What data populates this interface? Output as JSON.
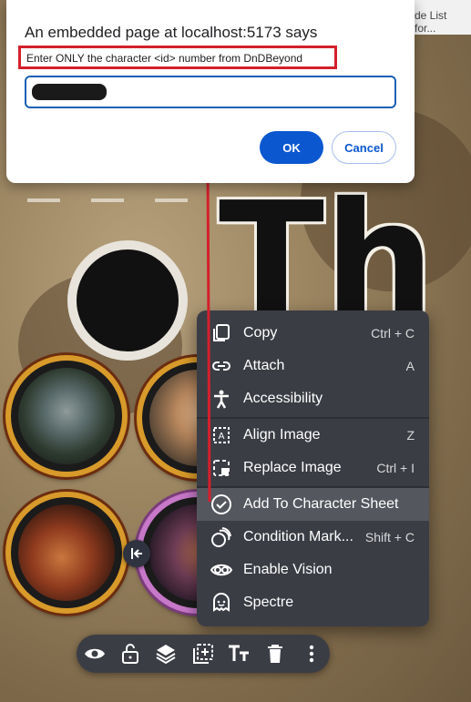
{
  "browser": {
    "tab_fragment": "de List for..."
  },
  "dialog": {
    "title": "An embedded page at localhost:5173 says",
    "message": "Enter ONLY the character <id> number from DnDBeyond",
    "input_value": "",
    "ok_label": "OK",
    "cancel_label": "Cancel"
  },
  "scene": {
    "heading_text": "Th"
  },
  "context_menu": {
    "items": [
      {
        "label": "Copy",
        "shortcut": "Ctrl + C",
        "icon": "copy-icon"
      },
      {
        "label": "Attach",
        "shortcut": "A",
        "icon": "attach-icon"
      },
      {
        "label": "Accessibility",
        "shortcut": "",
        "icon": "accessibility-icon"
      },
      {
        "label": "Align Image",
        "shortcut": "Z",
        "icon": "align-image-icon"
      },
      {
        "label": "Replace Image",
        "shortcut": "Ctrl + I",
        "icon": "replace-image-icon"
      },
      {
        "label": "Add To Character Sheet",
        "shortcut": "",
        "icon": "check-circle-icon"
      },
      {
        "label": "Condition Mark...",
        "shortcut": "Shift + C",
        "icon": "condition-markers-icon"
      },
      {
        "label": "Enable Vision",
        "shortcut": "",
        "icon": "vision-icon"
      },
      {
        "label": "Spectre",
        "shortcut": "",
        "icon": "ghost-icon"
      }
    ]
  },
  "toolbar": {
    "buttons": [
      "eye-icon",
      "lock-icon",
      "layers-icon",
      "add-image-icon",
      "text-size-icon",
      "trash-icon",
      "more-vertical-icon"
    ]
  },
  "colors": {
    "accent_blue": "#0b57d0",
    "annotation_red": "#d4202c",
    "menu_bg": "#3b3d45",
    "token_ring": "#d89a2a"
  }
}
